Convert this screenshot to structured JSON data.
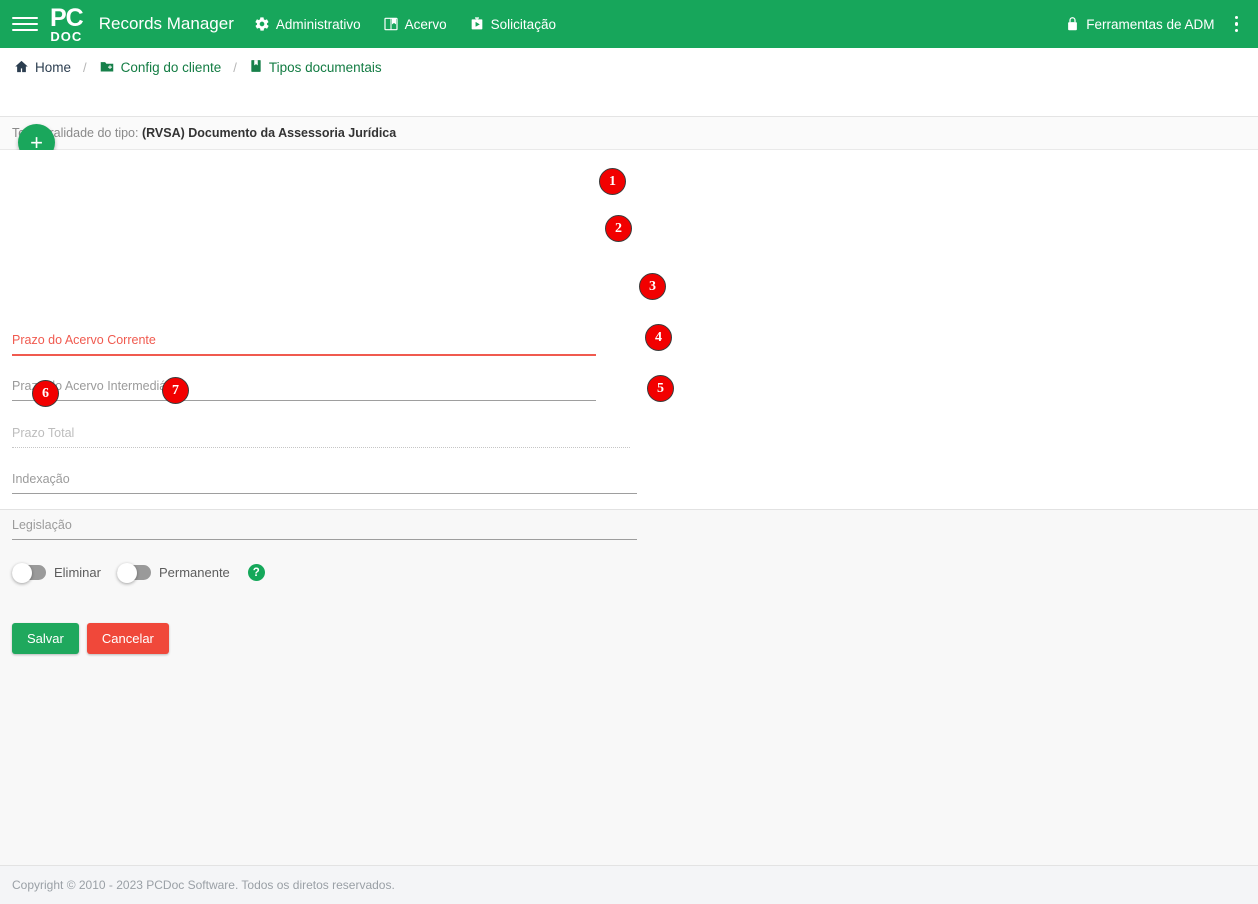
{
  "topbar": {
    "menu_icon": "hamburger-icon",
    "logo_line1": "PC",
    "logo_line2": "DOC",
    "brand": "Records Manager",
    "nav": [
      {
        "label": "Administrativo",
        "icon": "gear-icon"
      },
      {
        "label": "Acervo",
        "icon": "book-icon"
      },
      {
        "label": "Solicitação",
        "icon": "briefcase-icon"
      }
    ],
    "admin_tools": {
      "label": "Ferramentas de ADM",
      "icon": "lock-icon"
    },
    "more_icon": "vertical-dots-icon",
    "bg_color": "#17a65b"
  },
  "breadcrumb": {
    "items": [
      {
        "label": "Home",
        "icon": "home-icon"
      },
      {
        "label": "Config do cliente",
        "icon": "folder-add-icon"
      },
      {
        "label": "Tipos documentais",
        "icon": "document-icon"
      }
    ],
    "separator": "/",
    "add_button_label": "+"
  },
  "subtitle": {
    "prefix": "Temporalidade do tipo:",
    "value": "(RVSA) Documento da Assessoria Jurídica"
  },
  "form": {
    "fields": [
      {
        "label": "Prazo do Acervo Corrente",
        "value": "",
        "state": "error",
        "marker": "1"
      },
      {
        "label": "Prazo do Acervo Intermediário",
        "value": "",
        "state": "normal",
        "marker": "2"
      },
      {
        "label": "Prazo Total",
        "value": "",
        "state": "disabled",
        "marker": "3"
      },
      {
        "label": "Indexação",
        "value": "",
        "state": "normal",
        "marker": "4"
      },
      {
        "label": "Legislação",
        "value": "",
        "state": "normal",
        "marker": "5"
      }
    ],
    "toggles": [
      {
        "label": "Eliminar",
        "checked": false,
        "marker": "6"
      },
      {
        "label": "Permanente",
        "checked": false,
        "marker": "7"
      }
    ],
    "help_icon_label": "?",
    "buttons": {
      "save": "Salvar",
      "cancel": "Cancelar",
      "save_color": "#1fa85d",
      "cancel_color": "#f0483a"
    }
  },
  "footer": {
    "copyright": "Copyright © 2010 - 2023 PCDoc Software. Todos os diretos reservados."
  },
  "markers": {
    "m1": "1",
    "m2": "2",
    "m3": "3",
    "m4": "4",
    "m5": "5",
    "m6": "6",
    "m7": "7",
    "color": "#f20000"
  }
}
